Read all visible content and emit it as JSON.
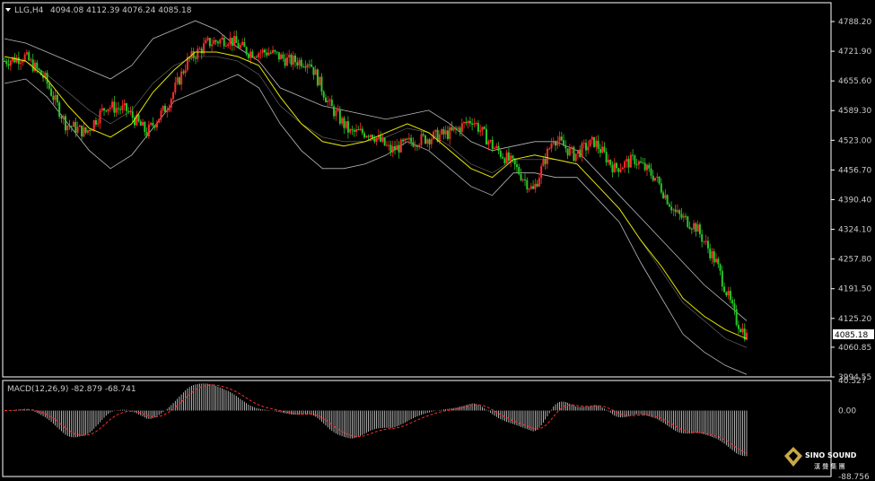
{
  "header": {
    "symbol": "LLG,H4",
    "ohlc": "4094.08 4112.39 4076.24 4085.18"
  },
  "price_axis": {
    "ticks": [
      "4788.20",
      "4721.90",
      "4655.60",
      "4589.30",
      "4523.00",
      "4456.70",
      "4390.40",
      "4324.10",
      "4257.80",
      "4191.50",
      "4125.20",
      "4060.85",
      "3994.55"
    ],
    "current_price": "4085.18"
  },
  "macd_panel": {
    "label": "MACD(12,26,9) -82.879 -68.741",
    "ticks": [
      "40.527",
      "0.00",
      "-88.756"
    ]
  },
  "logo": {
    "brand": "SINO SOUND",
    "cn_text": "漢 聲 集 團"
  },
  "colors": {
    "background": "#000000",
    "bull": "#ff2a2a",
    "bear": "#29c629",
    "bands": "#b8b8b8",
    "ma": "#e6e600",
    "macd_hist": "#d8d8d8",
    "signal": "#ff2a2a"
  },
  "chart_data": {
    "type": "line",
    "title": "LLG,H4",
    "x": "bar index (H4 bars, left to right)",
    "ylim": [
      3994.55,
      4788.2
    ],
    "close_approx": [
      {
        "bar": 0,
        "close": 4700
      },
      {
        "bar": 10,
        "close": 4710
      },
      {
        "bar": 20,
        "close": 4660
      },
      {
        "bar": 30,
        "close": 4560
      },
      {
        "bar": 40,
        "close": 4540
      },
      {
        "bar": 50,
        "close": 4600
      },
      {
        "bar": 60,
        "close": 4590
      },
      {
        "bar": 70,
        "close": 4540
      },
      {
        "bar": 80,
        "close": 4600
      },
      {
        "bar": 90,
        "close": 4700
      },
      {
        "bar": 100,
        "close": 4740
      },
      {
        "bar": 110,
        "close": 4750
      },
      {
        "bar": 120,
        "close": 4720
      },
      {
        "bar": 130,
        "close": 4720
      },
      {
        "bar": 140,
        "close": 4700
      },
      {
        "bar": 150,
        "close": 4700
      },
      {
        "bar": 160,
        "close": 4600
      },
      {
        "bar": 170,
        "close": 4540
      },
      {
        "bar": 180,
        "close": 4540
      },
      {
        "bar": 190,
        "close": 4500
      },
      {
        "bar": 200,
        "close": 4520
      },
      {
        "bar": 210,
        "close": 4530
      },
      {
        "bar": 220,
        "close": 4540
      },
      {
        "bar": 230,
        "close": 4570
      },
      {
        "bar": 240,
        "close": 4510
      },
      {
        "bar": 250,
        "close": 4470
      },
      {
        "bar": 260,
        "close": 4410
      },
      {
        "bar": 270,
        "close": 4530
      },
      {
        "bar": 280,
        "close": 4490
      },
      {
        "bar": 290,
        "close": 4520
      },
      {
        "bar": 300,
        "close": 4460
      },
      {
        "bar": 310,
        "close": 4480
      },
      {
        "bar": 320,
        "close": 4440
      },
      {
        "bar": 330,
        "close": 4360
      },
      {
        "bar": 340,
        "close": 4330
      },
      {
        "bar": 350,
        "close": 4250
      },
      {
        "bar": 360,
        "close": 4120
      },
      {
        "bar": 365,
        "close": 4085.18
      }
    ],
    "series": [
      {
        "values": [
          4750,
          4740,
          4720,
          4700,
          4680,
          4660,
          4690,
          4750,
          4770,
          4790,
          4770,
          4730,
          4700,
          4640,
          4620,
          4600,
          4590,
          4580,
          4570,
          4580,
          4590,
          4560,
          4520,
          4500,
          4510,
          4520,
          4520,
          4500,
          4450,
          4400,
          4350,
          4300,
          4250,
          4200,
          4160,
          4120
        ]
      },
      {
        "values": [
          4700,
          4700,
          4670,
          4630,
          4590,
          4560,
          4590,
          4650,
          4690,
          4710,
          4710,
          4700,
          4670,
          4600,
          4560,
          4530,
          4520,
          4520,
          4530,
          4550,
          4540,
          4510,
          4470,
          4450,
          4480,
          4480,
          4480,
          4470,
          4420,
          4370,
          4300,
          4230,
          4160,
          4120,
          4080,
          4060
        ]
      },
      {
        "values": [
          4650,
          4660,
          4620,
          4560,
          4500,
          4460,
          4490,
          4550,
          4610,
          4630,
          4650,
          4670,
          4640,
          4560,
          4500,
          4460,
          4460,
          4470,
          4490,
          4520,
          4500,
          4460,
          4420,
          4400,
          4450,
          4450,
          4440,
          4440,
          4390,
          4340,
          4250,
          4170,
          4090,
          4050,
          4020,
          4000
        ]
      },
      {
        "values": [
          4710,
          4700,
          4660,
          4600,
          4550,
          4530,
          4560,
          4630,
          4680,
          4720,
          4720,
          4710,
          4690,
          4620,
          4560,
          4520,
          4510,
          4520,
          4540,
          4560,
          4540,
          4500,
          4460,
          4440,
          4480,
          4490,
          4480,
          4470,
          4420,
          4370,
          4300,
          4240,
          4170,
          4130,
          4100,
          4080
        ]
      }
    ]
  }
}
